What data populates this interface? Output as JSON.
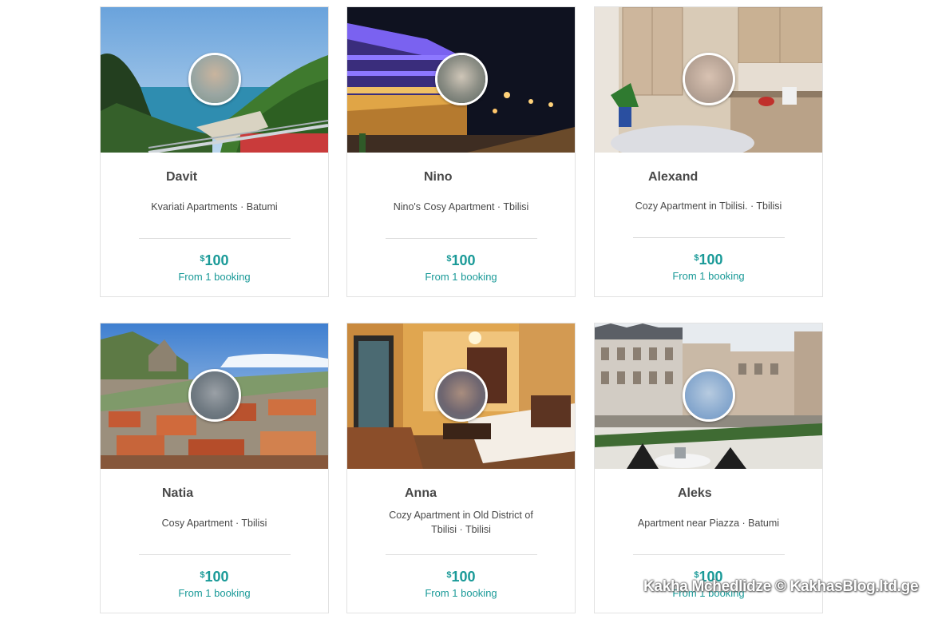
{
  "listings": [
    {
      "host": "Davit",
      "title": "Kvariati Apartments · Batumi",
      "currency": "$",
      "price": "100",
      "bookings": "From 1 booking"
    },
    {
      "host": "Nino",
      "title": "Nino's Cosy Apartment · Tbilisi",
      "currency": "$",
      "price": "100",
      "bookings": "From 1 booking"
    },
    {
      "host": "Alexand",
      "title": "Cozy Apartment in Tbilisi. · Tbilisi",
      "currency": "$",
      "price": "100",
      "bookings": "From 1 booking"
    },
    {
      "host": "Natia",
      "title": "Cosy Apartment · Tbilisi",
      "currency": "$",
      "price": "100",
      "bookings": "From 1 booking"
    },
    {
      "host": "Anna",
      "title": "Cozy Apartment in Old District of Tbilisi · Tbilisi",
      "currency": "$",
      "price": "100",
      "bookings": "From 1 booking"
    },
    {
      "host": "Aleks",
      "title": "Apartment near Piazza · Batumi",
      "currency": "$",
      "price": "100",
      "bookings": "From 1 booking"
    }
  ],
  "watermark": "Kakha Mchedlidze © KakhasBlog.ltd.ge",
  "colors": {
    "accent": "#1a9a98",
    "text": "#484848",
    "border": "#e2e2e2"
  }
}
